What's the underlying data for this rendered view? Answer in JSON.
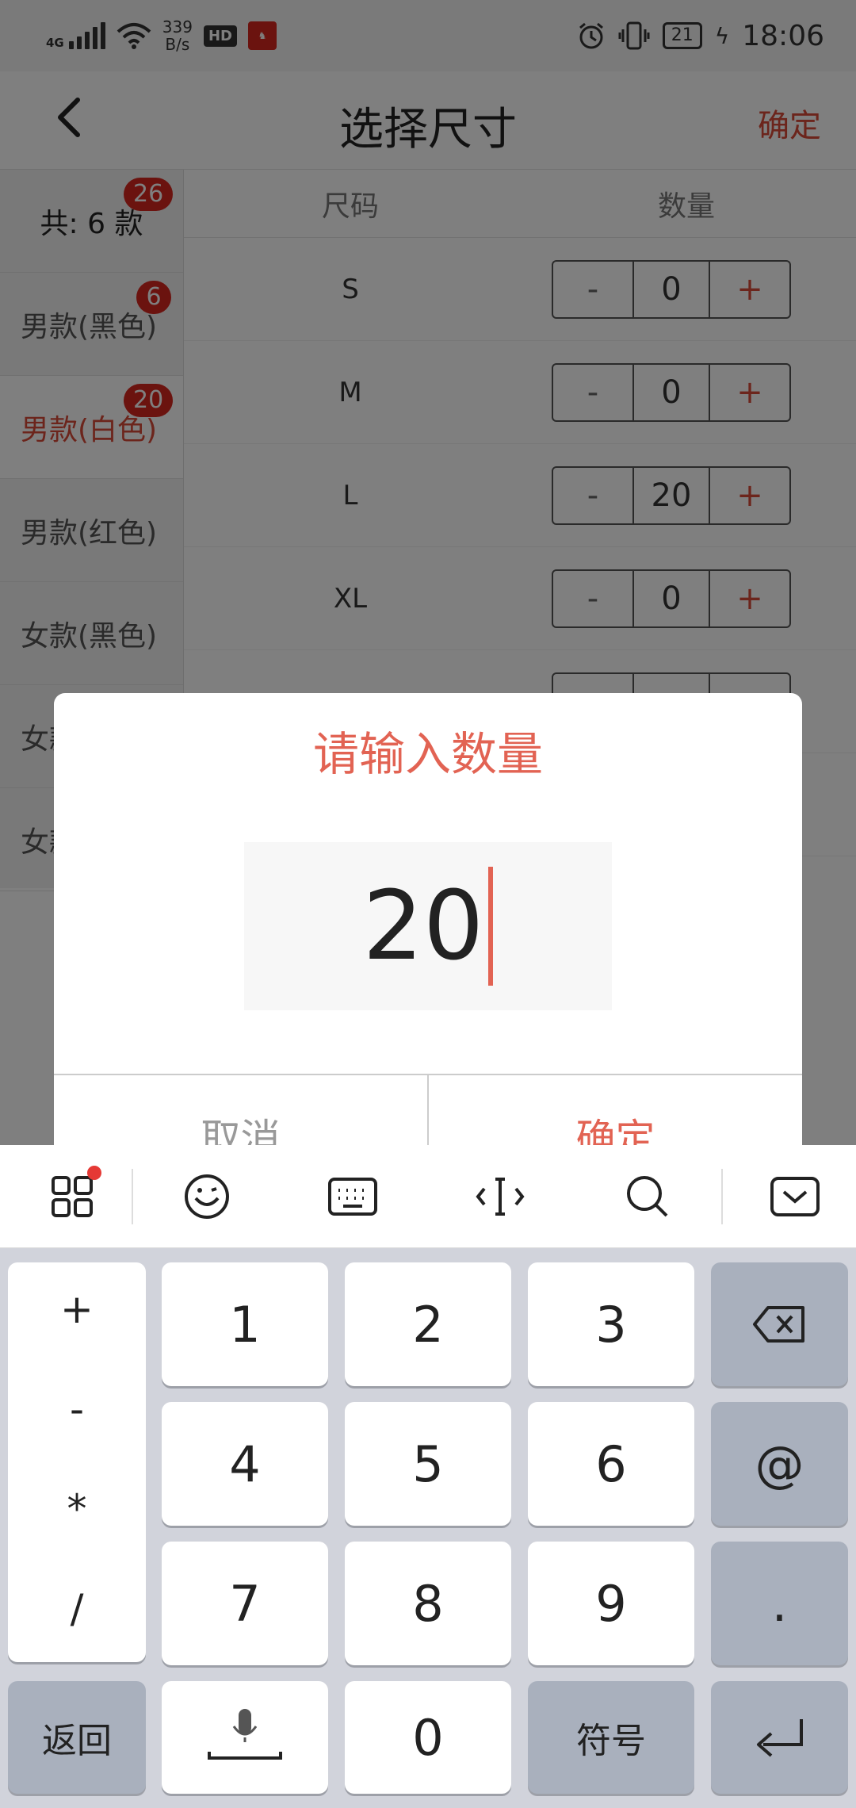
{
  "status_bar": {
    "network": "4G",
    "speed_value": "339",
    "speed_unit": "B/s",
    "hd_label": "HD",
    "battery": "21",
    "time": "18:06"
  },
  "header": {
    "title": "选择尺寸",
    "confirm_label": "确定"
  },
  "sidebar": {
    "total_label": "共: 6 款",
    "total_badge": "26",
    "items": [
      {
        "label": "男款(黑色)",
        "badge": "6"
      },
      {
        "label": "男款(白色)",
        "badge": "20"
      },
      {
        "label": "男款(红色)",
        "badge": ""
      },
      {
        "label": "女款(黑色)",
        "badge": ""
      },
      {
        "label": "女款",
        "badge": ""
      },
      {
        "label": "女款",
        "badge": ""
      }
    ]
  },
  "table": {
    "col_size": "尺码",
    "col_qty": "数量",
    "minus": "-",
    "plus": "+",
    "rows": [
      {
        "size": "S",
        "qty": "0"
      },
      {
        "size": "M",
        "qty": "0"
      },
      {
        "size": "L",
        "qty": "20"
      },
      {
        "size": "XL",
        "qty": "0"
      }
    ]
  },
  "dialog": {
    "title": "请输入数量",
    "input_value": "20",
    "cancel_label": "取消",
    "ok_label": "确定"
  },
  "keyboard": {
    "symbols": [
      "+",
      "-",
      "*",
      "/"
    ],
    "digits": [
      "1",
      "2",
      "3",
      "4",
      "5",
      "6",
      "7",
      "8",
      "9",
      "0"
    ],
    "at": "@",
    "dot": ".",
    "back_label": "返回",
    "symbol_label": "符号"
  },
  "colors": {
    "accent": "#e26353",
    "badge": "#d7261e",
    "keyboard_bg": "#d1d3db",
    "dark_key": "#a9b0bd"
  }
}
